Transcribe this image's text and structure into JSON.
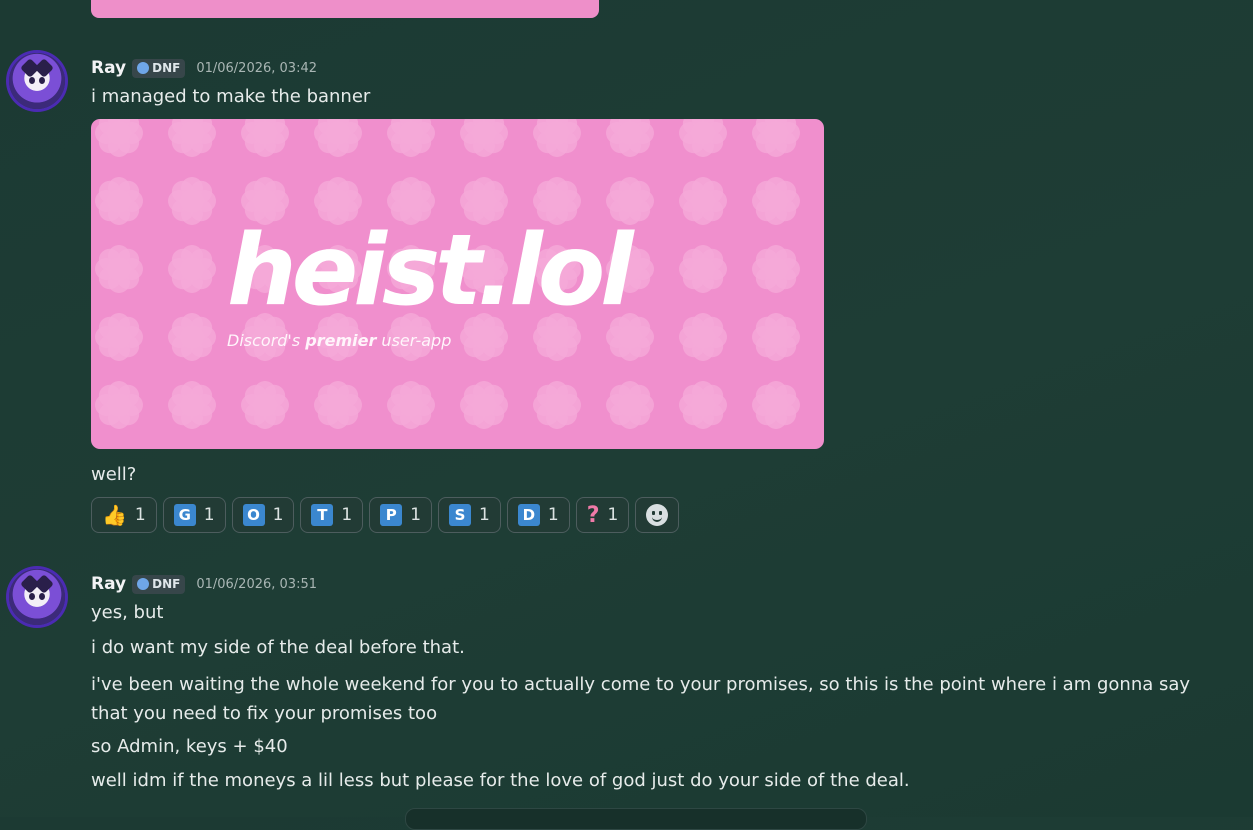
{
  "messages": [
    {
      "author": "Ray",
      "tag": "DNF",
      "timestamp": "01/06/2026, 03:42",
      "lines": [
        "i managed to make the banner"
      ],
      "attachment": {
        "title_left": "heist",
        "title_dot": ".",
        "title_right": "lol",
        "subtitle_prefix": "Discord's ",
        "subtitle_bold": "premier",
        "subtitle_suffix": " user-app",
        "background_color": "#f08fcd"
      },
      "followup": "well?",
      "reactions": [
        {
          "emoji": "👍",
          "icon": "thumbs-up-icon",
          "count": "1"
        },
        {
          "letter": "G",
          "count": "1"
        },
        {
          "letter": "O",
          "count": "1"
        },
        {
          "letter": "T",
          "count": "1"
        },
        {
          "letter": "P",
          "count": "1"
        },
        {
          "letter": "S",
          "count": "1"
        },
        {
          "letter": "D",
          "count": "1"
        },
        {
          "emoji": "?",
          "icon": "question-icon",
          "count": "1"
        }
      ]
    },
    {
      "author": "Ray",
      "tag": "DNF",
      "timestamp": "01/06/2026, 03:51",
      "lines": [
        "yes, but",
        "i do want my side of the deal before that.",
        "i've been waiting the whole weekend for you to actually come to your promises, so this is the point where i am gonna say that you need to fix your promises too",
        "so Admin, keys + $40",
        "well idm if the moneys a lil less but please for the love of god just do your side of the deal."
      ]
    }
  ],
  "colors": {
    "background": "#1d3b34",
    "reaction_letter": "#3b87cf",
    "banner_pink": "#f08fcd"
  }
}
